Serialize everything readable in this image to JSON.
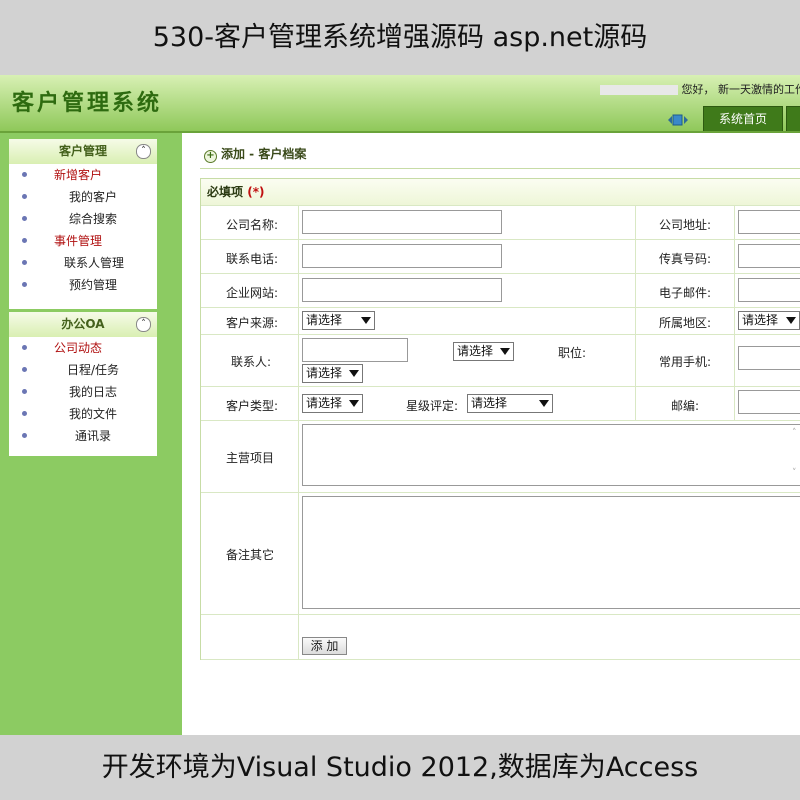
{
  "banner_top": "530-客户管理系统增强源码 asp.net源码",
  "banner_bottom": "开发环境为Visual Studio 2012,数据库为Access",
  "header": {
    "logo": "客户管理系统",
    "welcome_prefix": "您好，",
    "welcome_text": "新一天激情的工作已经",
    "nav_home": "系统首页"
  },
  "sidebar": {
    "panel1": {
      "title": "客户管理",
      "items": [
        "新增客户",
        "我的客户",
        "综合搜索",
        "事件管理",
        "联系人管理",
        "预约管理"
      ]
    },
    "panel2": {
      "title": "办公OA",
      "items": [
        "公司动态",
        "日程/任务",
        "我的日志",
        "我的文件",
        "通讯录"
      ]
    }
  },
  "content": {
    "breadcrumb": "添加 - 客户档案",
    "required_label": "必填项",
    "required_mark": "(*)",
    "fields": {
      "company_name": "公司名称:",
      "company_address": "公司地址:",
      "phone": "联系电话:",
      "fax": "传真号码:",
      "website": "企业网站:",
      "email": "电子邮件:",
      "source": "客户来源:",
      "region": "所属地区:",
      "contact": "联系人:",
      "position": "职位:",
      "mobile": "常用手机:",
      "customer_type": "客户类型:",
      "star_rating": "星级评定:",
      "postcode": "邮编:",
      "main_business": "主营项目",
      "remarks": "备注其它"
    },
    "select_placeholder": "请选择",
    "add_button": "添 加"
  }
}
